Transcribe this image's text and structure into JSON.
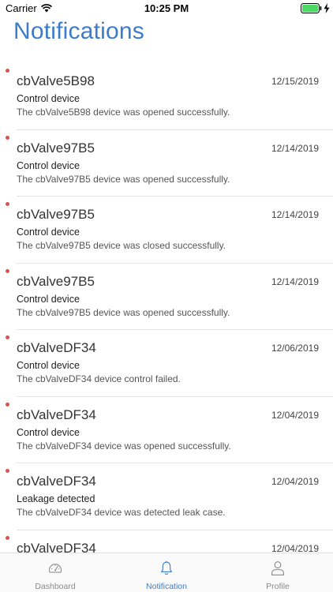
{
  "status_bar": {
    "carrier": "Carrier",
    "time": "10:25 PM",
    "battery_color": "#4cd964"
  },
  "page": {
    "title": "Notifications",
    "accent_color": "#3d7cc9",
    "unread_dot_color": "#d9534f"
  },
  "notifications": [
    {
      "device": "cbValve5B98",
      "date": "12/15/2019",
      "type": "Control device",
      "message": "The cbValve5B98 device was opened successfully."
    },
    {
      "device": "cbValve97B5",
      "date": "12/14/2019",
      "type": "Control device",
      "message": "The cbValve97B5 device was opened successfully."
    },
    {
      "device": "cbValve97B5",
      "date": "12/14/2019",
      "type": "Control device",
      "message": "The cbValve97B5 device was closed successfully."
    },
    {
      "device": "cbValve97B5",
      "date": "12/14/2019",
      "type": "Control device",
      "message": "The cbValve97B5 device was opened successfully."
    },
    {
      "device": "cbValveDF34",
      "date": "12/06/2019",
      "type": "Control device",
      "message": "The cbValveDF34 device control failed."
    },
    {
      "device": "cbValveDF34",
      "date": "12/04/2019",
      "type": "Control device",
      "message": "The cbValveDF34 device was opened successfully."
    },
    {
      "device": "cbValveDF34",
      "date": "12/04/2019",
      "type": "Leakage detected",
      "message": "The cbValveDF34 device was detected leak case."
    },
    {
      "device": "cbValveDF34",
      "date": "12/04/2019",
      "type": "",
      "message": ""
    }
  ],
  "tab_bar": {
    "tabs": [
      {
        "label": "Dashboard",
        "icon": "gauge-icon",
        "active": false
      },
      {
        "label": "Notification",
        "icon": "bell-icon",
        "active": true
      },
      {
        "label": "Profile",
        "icon": "user-icon",
        "active": false
      }
    ]
  }
}
